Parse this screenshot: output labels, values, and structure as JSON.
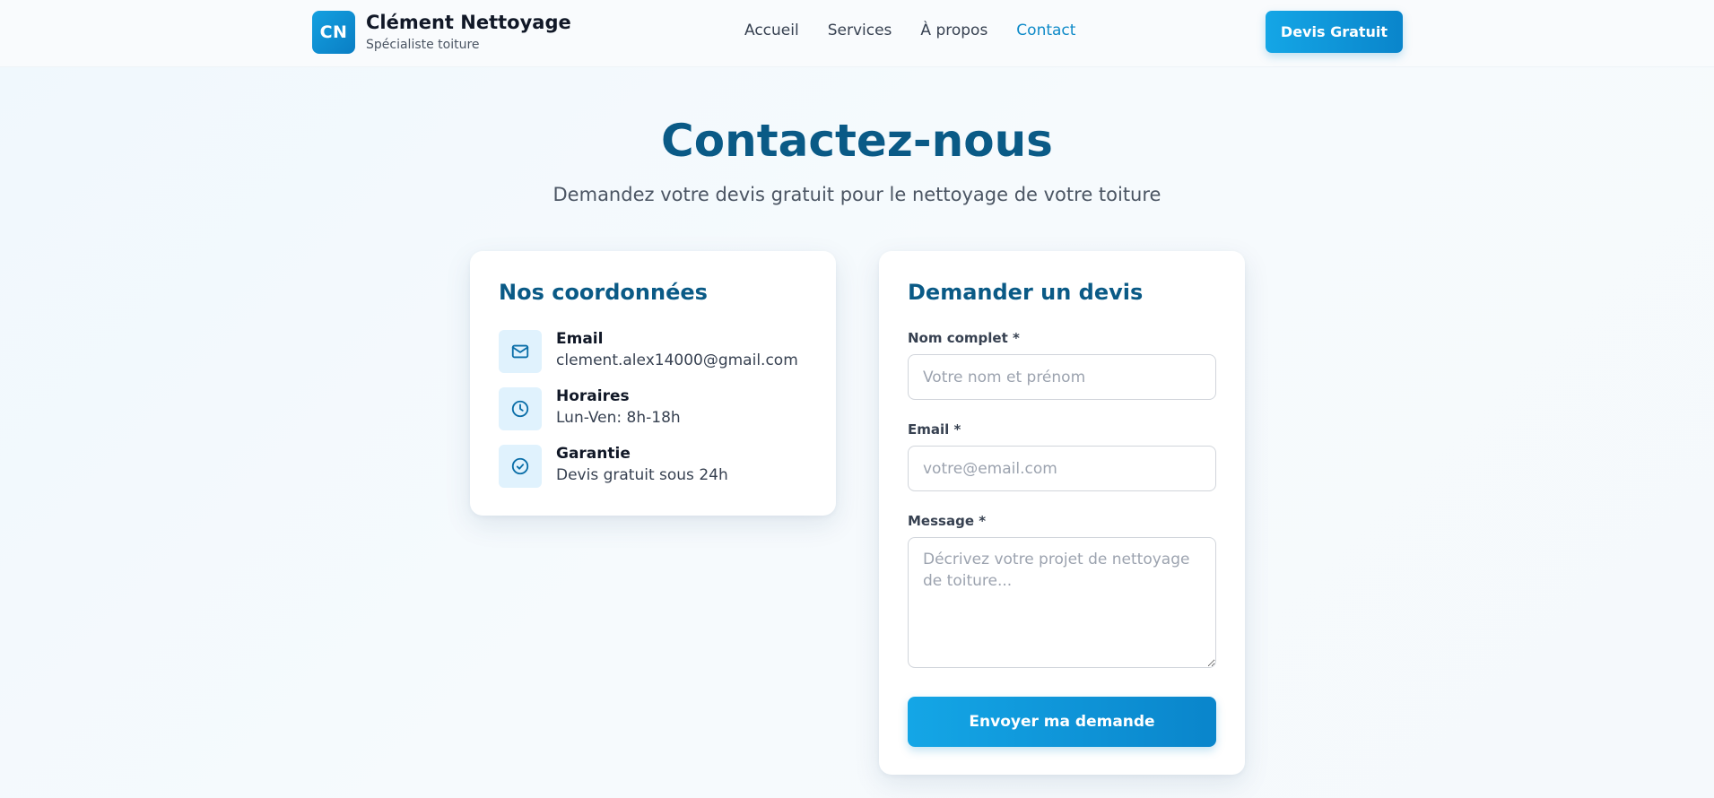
{
  "header": {
    "logo_text": "CN",
    "brand_name": "Clément Nettoyage",
    "brand_tagline": "Spécialiste toiture",
    "nav": [
      {
        "label": "Accueil",
        "active": false
      },
      {
        "label": "Services",
        "active": false
      },
      {
        "label": "À propos",
        "active": false
      },
      {
        "label": "Contact",
        "active": true
      }
    ],
    "cta_label": "Devis Gratuit"
  },
  "hero": {
    "title": "Contactez-nous",
    "subtitle": "Demandez votre devis gratuit pour le nettoyage de votre toiture"
  },
  "info_card": {
    "title": "Nos coordonnées",
    "items": [
      {
        "icon": "mail-icon",
        "label": "Email",
        "value": "clement.alex14000@gmail.com"
      },
      {
        "icon": "clock-icon",
        "label": "Horaires",
        "value": "Lun-Ven: 8h-18h"
      },
      {
        "icon": "check-circle-icon",
        "label": "Garantie",
        "value": "Devis gratuit sous 24h"
      }
    ]
  },
  "form": {
    "title": "Demander un devis",
    "name_label": "Nom complet *",
    "name_placeholder": "Votre nom et prénom",
    "name_value": "",
    "email_label": "Email *",
    "email_placeholder": "votre@email.com",
    "email_value": "",
    "message_label": "Message *",
    "message_placeholder": "Décrivez votre projet de nettoyage de toiture...",
    "message_value": "",
    "submit_label": "Envoyer ma demande"
  },
  "colors": {
    "primary": "#0e8ac8",
    "heading": "#0a5a86",
    "icon_bg": "#e0f2fd"
  }
}
